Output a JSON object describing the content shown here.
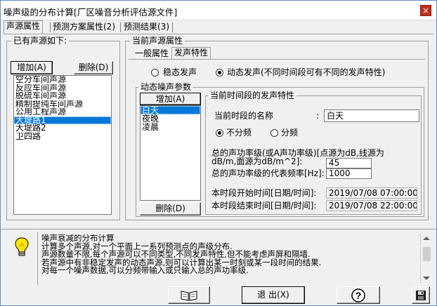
{
  "window": {
    "title": "噪声级的分布计算[厂区噪音分析评估源文件]",
    "close_label": "×"
  },
  "top_tabs": [
    {
      "label": "声源属性"
    },
    {
      "label": "预测方案属性(2)"
    },
    {
      "label": "预测结果(3)"
    }
  ],
  "sources": {
    "legend": "已有声源如下:",
    "add_label": "增加(A)",
    "delete_label": "删除(D)",
    "items": [
      "空分车间声源",
      "反应车间声源",
      "脱硫车间声源",
      "精制提纯车间声源",
      "公用工程声源",
      "大堤路1",
      "大堤路2",
      "卫四路"
    ],
    "selected_index": 5
  },
  "current": {
    "legend": "当前声源属性",
    "tabs": [
      {
        "label": "一般属性"
      },
      {
        "label": "发声特性"
      }
    ],
    "radio_steady": "稳态发声",
    "radio_dynamic": "动态发声(不同时间段可有不同的发声特性)"
  },
  "dynamic": {
    "legend": "动态噪声参数",
    "add_label": "增加(A)",
    "delete_label": "删除(D)",
    "items": [
      "白天",
      "夜晚",
      "凌晨"
    ],
    "selected_index": 0
  },
  "period": {
    "legend": "当前时间段的发声特性",
    "name_label": "当前时段的名称",
    "name_colon": ":",
    "name_value": "白天",
    "radio_no_freq": "不分频",
    "radio_freq": "分频",
    "power_label_1": "总的声功率级(或A声功率级)[点源为dB,线源为",
    "power_label_2": "dB/m,面源为dB/m^2]:",
    "power_value": "45",
    "freq_label": "总的声功率级的代表频率[Hz]:",
    "freq_value": "1000",
    "start_label": "本时段开始时间[日期/时间]:",
    "start_value": "2019/07/08 07:00:00",
    "end_label": "本时段结束时间[日期/时间]:",
    "end_value": "2019/07/08 22:00:00"
  },
  "tip": {
    "lines": [
      "噪声衰减的分布计算",
      "计算多个声源,对一个平面上一系列预测点的声级分布.",
      "声源数量不限,每个声源可以不同类型,不同发声特性,但不能考虑声屏和隔墙.",
      "若声源中有非稳定发声的动态声源,则可以计算出某一时刻或某一段时间的结果.",
      "对每一个噪声数据,可以分频带输入或只输入总的声功率级."
    ]
  },
  "bottom": {
    "exit_label": "退 出(X)",
    "help_label": "?"
  }
}
